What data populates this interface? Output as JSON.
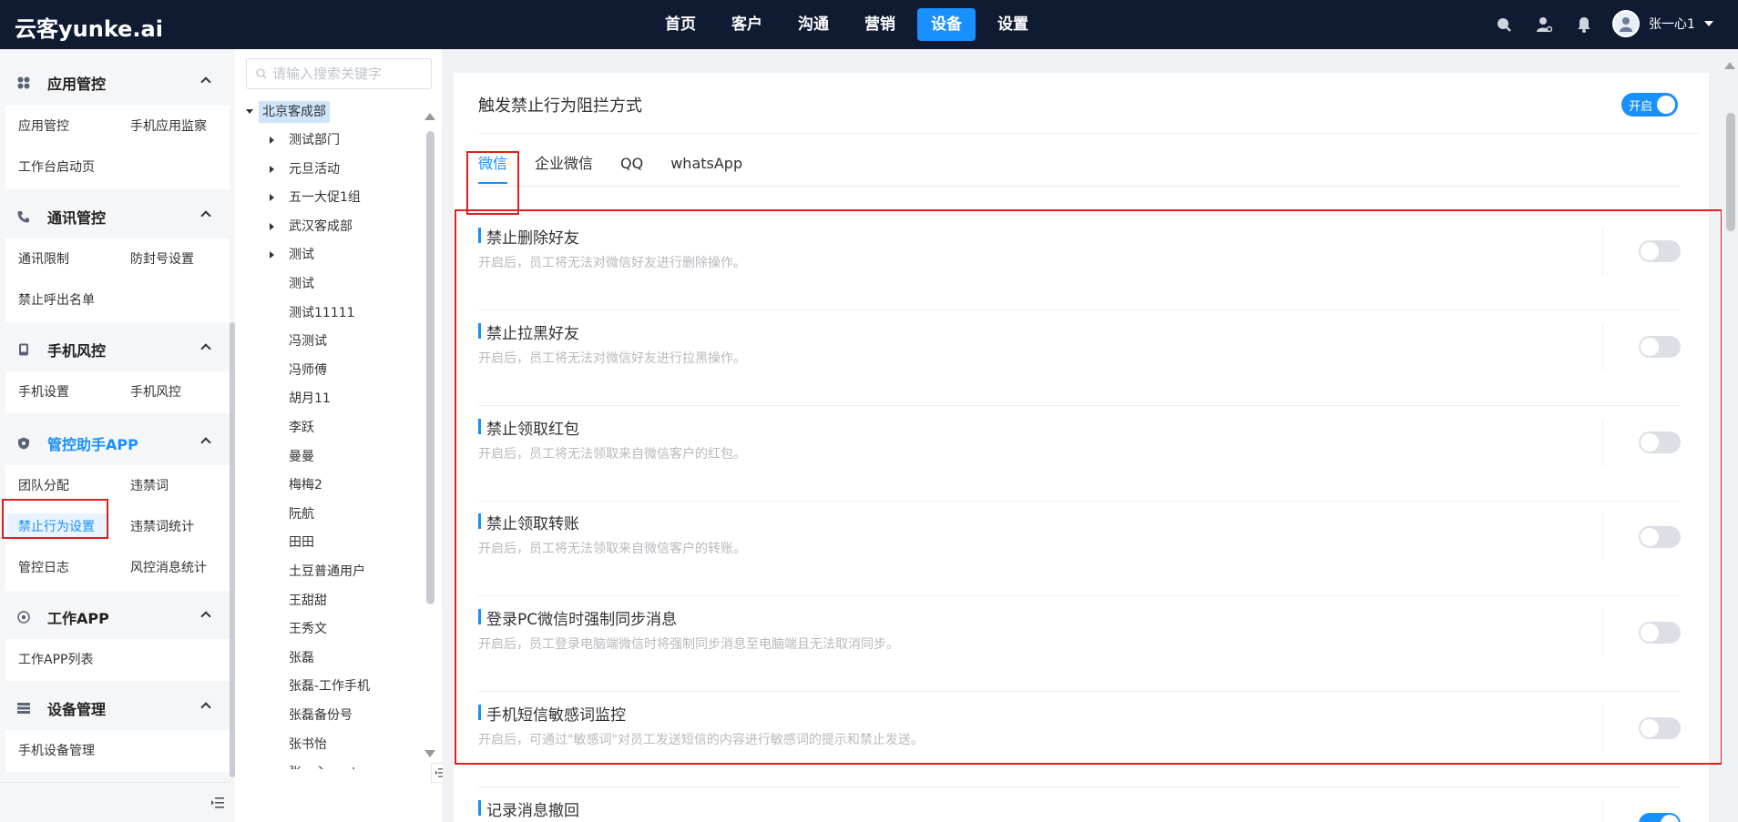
{
  "app": {
    "logo": "云客yunke.ai"
  },
  "topnav": {
    "items": [
      "首页",
      "客户",
      "沟通",
      "营销",
      "设备",
      "设置"
    ],
    "active": "设备",
    "user_name": "张一心1"
  },
  "sidebar": {
    "groups": [
      {
        "title": "应用管控",
        "icon": "apps-icon",
        "items": [
          "应用管控",
          "手机应用监察",
          "工作台启动页"
        ]
      },
      {
        "title": "通讯管控",
        "icon": "phone-icon",
        "items": [
          "通讯限制",
          "防封号设置",
          "禁止呼出名单"
        ]
      },
      {
        "title": "手机风控",
        "icon": "mobile-icon",
        "items": [
          "手机设置",
          "手机风控"
        ]
      },
      {
        "title": "管控助手APP",
        "icon": "shield-icon",
        "items": [
          "团队分配",
          "违禁词",
          "禁止行为设置",
          "违禁词统计",
          "管控日志",
          "风控消息统计"
        ]
      },
      {
        "title": "工作APP",
        "icon": "target-icon",
        "items": [
          "工作APP列表"
        ]
      },
      {
        "title": "设备管理",
        "icon": "list-icon",
        "items": [
          "手机设备管理"
        ]
      }
    ],
    "active_item": "禁止行为设置"
  },
  "tree": {
    "search_placeholder": "请输入搜索关键字",
    "root": "北京客成部",
    "nodes": [
      {
        "label": "测试部门",
        "expandable": true
      },
      {
        "label": "元旦活动",
        "expandable": true
      },
      {
        "label": "五一大促1组",
        "expandable": true
      },
      {
        "label": "武汉客成部",
        "expandable": true
      },
      {
        "label": "测试",
        "expandable": true
      },
      {
        "label": "测试",
        "expandable": false
      },
      {
        "label": "测试11111",
        "expandable": false
      },
      {
        "label": "冯测试",
        "expandable": false
      },
      {
        "label": "冯师傅",
        "expandable": false
      },
      {
        "label": "胡月11",
        "expandable": false
      },
      {
        "label": "李跃",
        "expandable": false
      },
      {
        "label": "曼曼",
        "expandable": false
      },
      {
        "label": "梅梅2",
        "expandable": false
      },
      {
        "label": "阮航",
        "expandable": false
      },
      {
        "label": "田田",
        "expandable": false
      },
      {
        "label": "土豆普通用户",
        "expandable": false
      },
      {
        "label": "王甜甜",
        "expandable": false
      },
      {
        "label": "王秀文",
        "expandable": false
      },
      {
        "label": "张磊",
        "expandable": false
      },
      {
        "label": "张磊-工作手机",
        "expandable": false
      },
      {
        "label": "张磊备份号",
        "expandable": false
      },
      {
        "label": "张书怡",
        "expandable": false
      },
      {
        "label": "张一心-meta",
        "expandable": false
      }
    ]
  },
  "main": {
    "header_title": "触发禁止行为阻拦方式",
    "header_toggle_label": "开启",
    "header_toggle_on": true,
    "tabs": [
      "微信",
      "企业微信",
      "QQ",
      "whatsApp"
    ],
    "active_tab": "微信",
    "settings": [
      {
        "title": "禁止删除好友",
        "desc": "开启后，员工将无法对微信好友进行删除操作。",
        "on": false
      },
      {
        "title": "禁止拉黑好友",
        "desc": "开启后，员工将无法对微信好友进行拉黑操作。",
        "on": false
      },
      {
        "title": "禁止领取红包",
        "desc": "开启后，员工将无法领取来自微信客户的红包。",
        "on": false
      },
      {
        "title": "禁止领取转账",
        "desc": "开启后，员工将无法领取来自微信客户的转账。",
        "on": false
      },
      {
        "title": "登录PC微信时强制同步消息",
        "desc": "开启后，员工登录电脑端微信时将强制同步消息至电脑端且无法取消同步。",
        "on": false
      },
      {
        "title": "手机短信敏感词监控",
        "desc": "开启后，可通过\"敏感词\"对员工发送短信的内容进行敏感词的提示和禁止发送。",
        "on": false
      },
      {
        "title": "记录消息撤回",
        "desc": "",
        "on": true
      }
    ]
  },
  "colors": {
    "topbar_bg": "#0f1b33",
    "accent": "#1890ff",
    "highlight_border": "#e02020"
  }
}
